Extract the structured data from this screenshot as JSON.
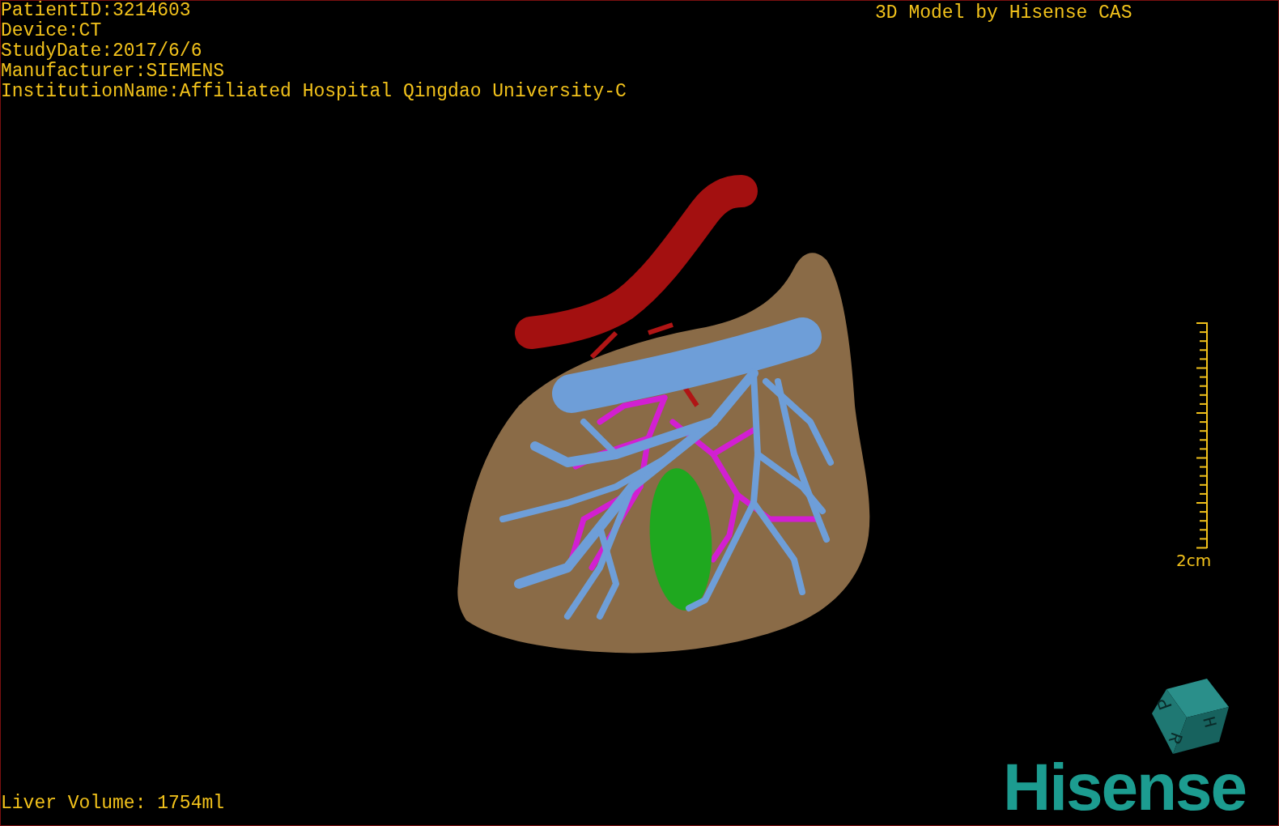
{
  "patient_info": [
    "PatientID:3214603",
    "Device:CT",
    "StudyDate:2017/6/6",
    "Manufacturer:SIEMENS",
    "InstitutionName:Affiliated Hospital Qingdao University-C"
  ],
  "title": "3D Model by Hisense CAS",
  "scale_bar": {
    "label": "2cm"
  },
  "orientation_cube": {
    "labels": [
      "P",
      "H",
      "R"
    ]
  },
  "logo": "Hisense",
  "liver_volume": "Liver Volume: 1754ml"
}
